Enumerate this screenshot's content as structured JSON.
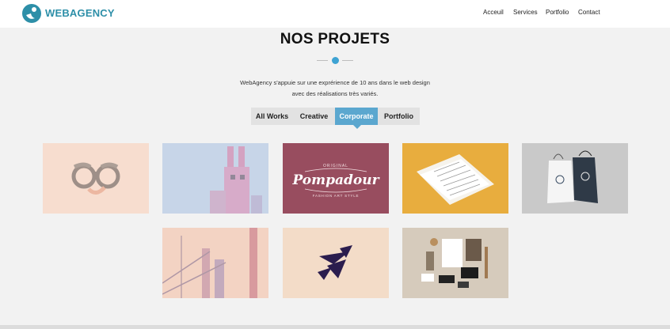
{
  "header": {
    "brand": "WEBAGENCY",
    "logo_icon": "webagency-logo-icon",
    "nav": [
      "Acceuil",
      "Services",
      "Portfolio",
      "Contact"
    ]
  },
  "section": {
    "title": "NOS PROJETS",
    "description_line1": "WebAgency s'appuie sur une exprérience de 10 ans dans le web design",
    "description_line2": "avec des réalisations très variés."
  },
  "filters": {
    "items": [
      "All Works",
      "Creative",
      "Corporate",
      "Portfolio"
    ],
    "active": "Corporate"
  },
  "portfolio": {
    "items": [
      {
        "name": "glasses-illustration",
        "faded": true
      },
      {
        "name": "pink-rabbit-illustration",
        "faded": true
      },
      {
        "name": "pompadour-logo",
        "faded": false,
        "logo_top": "ORIGINAL",
        "logo_main": "Pompadour",
        "logo_bottom": "FASHION ART STYLE"
      },
      {
        "name": "documents-mockup",
        "faded": false
      },
      {
        "name": "shopping-bags-mockup",
        "faded": false
      },
      {
        "name": "city-illustration",
        "faded": true
      },
      {
        "name": "abstract-logo",
        "faded": false
      },
      {
        "name": "stationery-mockup",
        "faded": false
      }
    ]
  },
  "colors": {
    "accent": "#5ba7cf",
    "brand": "#2d8fa8",
    "background": "#f2f2f2"
  }
}
